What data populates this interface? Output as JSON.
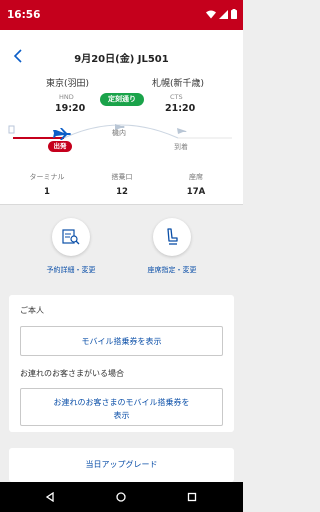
{
  "status_bar": {
    "time": "16:56"
  },
  "header": {
    "title": "9月20日(金) JL501"
  },
  "departure": {
    "city": "東京(羽田)",
    "code": "HND",
    "time": "19:20",
    "status": "出発"
  },
  "arrival": {
    "city": "札幌(新千歳)",
    "code": "CTS",
    "time": "21:20",
    "status": "到着"
  },
  "flight_status": "定刻通り",
  "route_label": "機内",
  "details": [
    {
      "label": "ターミナル",
      "value": "1"
    },
    {
      "label": "搭乗口",
      "value": "12"
    },
    {
      "label": "座席",
      "value": "17A"
    }
  ],
  "actions": {
    "booking_label": "予約詳細・変更",
    "seat_label": "座席指定・変更"
  },
  "passenger_panel": {
    "self_heading": "ご本人",
    "self_button": "モバイル搭乗券を表示",
    "companion_heading": "お連れのお客さまがいる場合",
    "companion_button_line1": "お連れのお客さまのモバイル搭乗券を",
    "companion_button_line2": "表示"
  },
  "upgrade_label": "当日アップグレード",
  "colors": {
    "brand_red": "#c5001c",
    "status_green": "#1aa34a",
    "link_blue": "#0b4fa8"
  },
  "icons": [
    "wifi-icon",
    "signal-icon",
    "battery-icon",
    "back-arrow-icon",
    "plane-icon",
    "booking-icon",
    "seat-icon",
    "nav-back-icon",
    "nav-home-icon",
    "nav-recents-icon"
  ]
}
